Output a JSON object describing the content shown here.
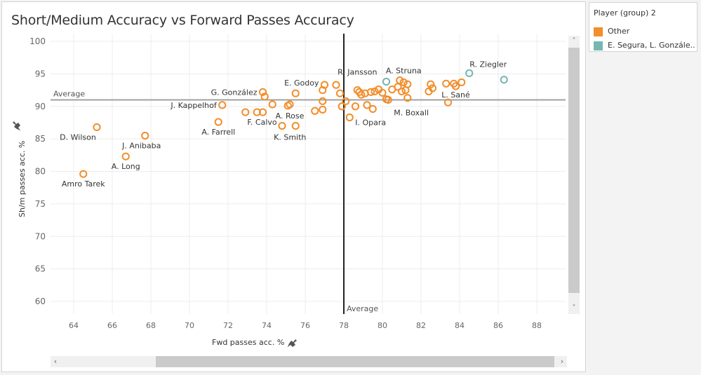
{
  "colors": {
    "other": "#f28e2b",
    "segura_group": "#76b7b2",
    "gridline": "#ececec",
    "avg_h": "#a0a0a0",
    "avg_v": "#222222"
  },
  "legend": {
    "title": "Player (group) 2",
    "items": [
      {
        "label": "Other",
        "color": "#f28e2b"
      },
      {
        "label": "E. Segura, L. Gonzále..",
        "color": "#76b7b2"
      }
    ]
  },
  "scrollbars": {
    "left_arrow": "‹",
    "right_arrow": "›",
    "up_arrow": "˄",
    "down_arrow": "˅"
  },
  "chart_data": {
    "type": "scatter",
    "title": "Short/Medium Accuracy vs Forward Passes Accuracy",
    "xlabel": "Fwd passes acc. %",
    "ylabel": "Sh/m passes acc. %",
    "xlim": [
      63,
      89.5
    ],
    "ylim": [
      58,
      101
    ],
    "xticks": [
      64,
      66,
      68,
      70,
      72,
      74,
      76,
      78,
      80,
      82,
      84,
      86,
      88
    ],
    "yticks": [
      60,
      65,
      70,
      75,
      80,
      85,
      90,
      95,
      100
    ],
    "grid": true,
    "reference_lines": [
      {
        "axis": "y",
        "value": 91.0,
        "label": "Average"
      },
      {
        "axis": "x",
        "value": 78.0,
        "label": "Average"
      }
    ],
    "series": [
      {
        "name": "Other",
        "points": [
          {
            "x": 64.5,
            "y": 79.6,
            "label": "Amro Tarek"
          },
          {
            "x": 65.2,
            "y": 86.8,
            "label": "D. Wilson"
          },
          {
            "x": 66.7,
            "y": 82.3,
            "label": "A. Long"
          },
          {
            "x": 67.7,
            "y": 85.5,
            "label": "J. Anibaba"
          },
          {
            "x": 71.5,
            "y": 87.6,
            "label": "A. Farrell"
          },
          {
            "x": 71.7,
            "y": 90.2,
            "label": "J. Kappelhof"
          },
          {
            "x": 72.9,
            "y": 89.1,
            "label": ""
          },
          {
            "x": 73.5,
            "y": 89.1,
            "label": ""
          },
          {
            "x": 73.8,
            "y": 89.1,
            "label": "F. Calvo"
          },
          {
            "x": 73.8,
            "y": 92.2,
            "label": "G. González"
          },
          {
            "x": 73.9,
            "y": 91.5,
            "label": ""
          },
          {
            "x": 74.3,
            "y": 90.3,
            "label": ""
          },
          {
            "x": 74.8,
            "y": 87.0,
            "label": ""
          },
          {
            "x": 75.1,
            "y": 90.1,
            "label": ""
          },
          {
            "x": 75.2,
            "y": 90.3,
            "label": "A. Rose"
          },
          {
            "x": 75.5,
            "y": 87.0,
            "label": "K. Smith"
          },
          {
            "x": 75.5,
            "y": 92.0,
            "label": ""
          },
          {
            "x": 76.5,
            "y": 89.3,
            "label": ""
          },
          {
            "x": 76.9,
            "y": 89.5,
            "label": ""
          },
          {
            "x": 76.9,
            "y": 90.8,
            "label": ""
          },
          {
            "x": 76.9,
            "y": 92.5,
            "label": ""
          },
          {
            "x": 77.0,
            "y": 93.3,
            "label": "E. Godoy"
          },
          {
            "x": 77.6,
            "y": 93.3,
            "label": ""
          },
          {
            "x": 77.8,
            "y": 92.0,
            "label": ""
          },
          {
            "x": 77.9,
            "y": 90.0,
            "label": ""
          },
          {
            "x": 78.1,
            "y": 90.8,
            "label": ""
          },
          {
            "x": 78.3,
            "y": 88.3,
            "label": "I. Opara"
          },
          {
            "x": 78.6,
            "y": 90.0,
            "label": ""
          },
          {
            "x": 78.7,
            "y": 92.5,
            "label": "R. Jansson"
          },
          {
            "x": 78.8,
            "y": 92.2,
            "label": ""
          },
          {
            "x": 78.9,
            "y": 91.8,
            "label": ""
          },
          {
            "x": 79.1,
            "y": 92.0,
            "label": ""
          },
          {
            "x": 79.2,
            "y": 90.2,
            "label": ""
          },
          {
            "x": 79.4,
            "y": 92.2,
            "label": ""
          },
          {
            "x": 79.5,
            "y": 89.6,
            "label": ""
          },
          {
            "x": 79.6,
            "y": 92.3,
            "label": ""
          },
          {
            "x": 79.8,
            "y": 92.6,
            "label": ""
          },
          {
            "x": 80.0,
            "y": 92.1,
            "label": ""
          },
          {
            "x": 80.2,
            "y": 91.1,
            "label": ""
          },
          {
            "x": 80.3,
            "y": 91.0,
            "label": "M. Boxall"
          },
          {
            "x": 80.5,
            "y": 92.6,
            "label": ""
          },
          {
            "x": 80.8,
            "y": 93.0,
            "label": ""
          },
          {
            "x": 80.9,
            "y": 94.0,
            "label": ""
          },
          {
            "x": 81.0,
            "y": 92.3,
            "label": ""
          },
          {
            "x": 81.1,
            "y": 93.7,
            "label": "A. Struna"
          },
          {
            "x": 81.2,
            "y": 92.5,
            "label": ""
          },
          {
            "x": 81.3,
            "y": 93.4,
            "label": ""
          },
          {
            "x": 81.3,
            "y": 91.3,
            "label": ""
          },
          {
            "x": 82.4,
            "y": 92.3,
            "label": ""
          },
          {
            "x": 82.5,
            "y": 93.4,
            "label": ""
          },
          {
            "x": 82.6,
            "y": 92.8,
            "label": ""
          },
          {
            "x": 83.3,
            "y": 93.5,
            "label": ""
          },
          {
            "x": 83.4,
            "y": 90.6,
            "label": ""
          },
          {
            "x": 83.7,
            "y": 93.5,
            "label": ""
          },
          {
            "x": 83.8,
            "y": 93.1,
            "label": "L. Sané"
          },
          {
            "x": 84.1,
            "y": 93.7,
            "label": ""
          }
        ]
      },
      {
        "name": "E. Segura, L. Gonzále..",
        "points": [
          {
            "x": 80.2,
            "y": 93.8,
            "label": ""
          },
          {
            "x": 84.5,
            "y": 95.1,
            "label": "R. Ziegler"
          },
          {
            "x": 86.3,
            "y": 94.1,
            "label": ""
          }
        ]
      }
    ]
  }
}
